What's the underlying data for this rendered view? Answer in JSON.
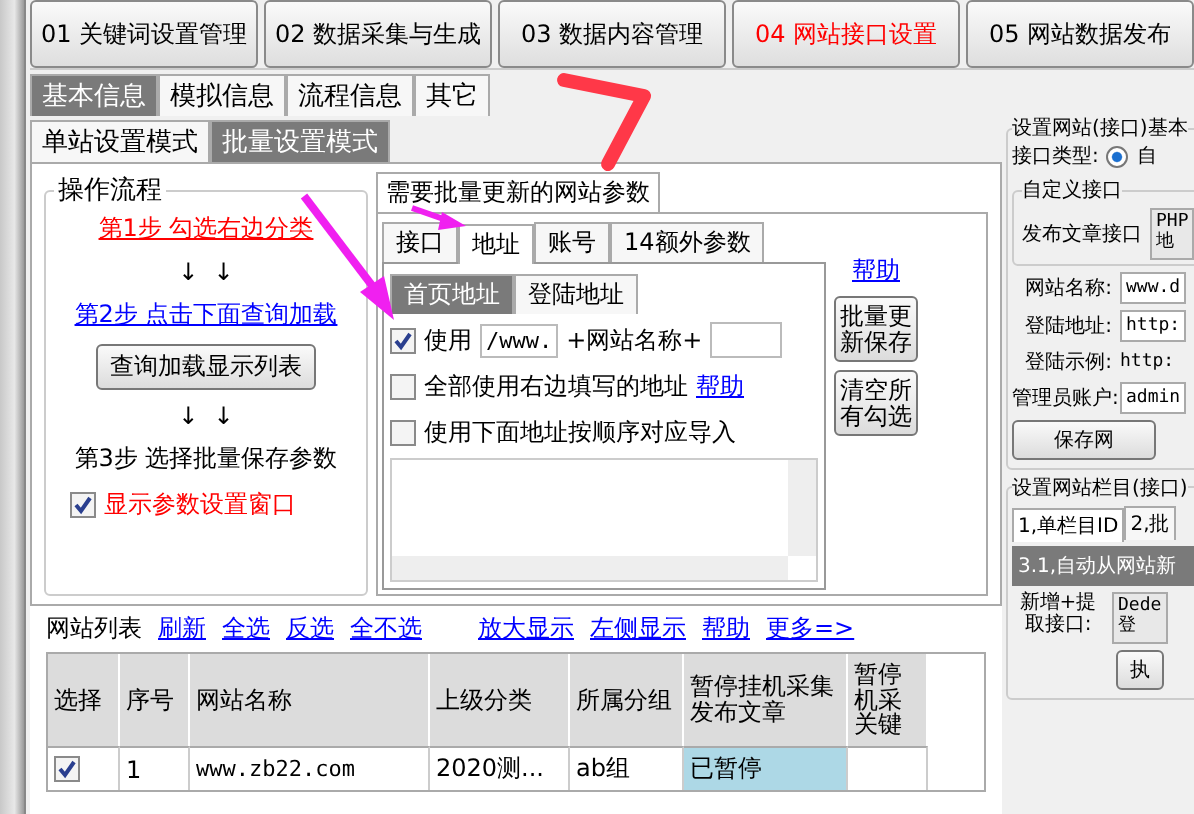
{
  "module_tabs": [
    {
      "label": "01 关键词设置管理",
      "selected": false
    },
    {
      "label": "02 数据采集与生成",
      "selected": false
    },
    {
      "label": "03 数据内容管理",
      "selected": false
    },
    {
      "label": "04 网站接口设置",
      "selected": true
    },
    {
      "label": "05 网站数据发布",
      "selected": false
    }
  ],
  "info_tabs": [
    {
      "label": "基本信息",
      "selected": true
    },
    {
      "label": "模拟信息",
      "selected": false
    },
    {
      "label": "流程信息",
      "selected": false
    },
    {
      "label": "其它",
      "selected": false
    }
  ],
  "mode_tabs": [
    {
      "label": "单站设置模式",
      "selected": false
    },
    {
      "label": "批量设置模式",
      "selected": true
    }
  ],
  "workflow": {
    "title": "操作流程",
    "step1": "第1步  勾选右边分类",
    "arrows_1": "↓  ↓",
    "step2": "第2步  点击下面查询加载",
    "load_button": "查询加载显示列表",
    "arrows_2": "↓  ↓",
    "step3": "第3步  选择批量保存参数",
    "show_window": {
      "label": "显示参数设置窗口",
      "checked": true
    }
  },
  "batch_params": {
    "title": "需要批量更新的网站参数",
    "tabs": [
      {
        "label": "接口",
        "selected": false
      },
      {
        "label": "地址",
        "selected": true
      },
      {
        "label": "账号",
        "selected": false
      },
      {
        "label": "14额外参数",
        "selected": false
      }
    ],
    "address_tabs": [
      {
        "label": "首页地址",
        "selected": true
      },
      {
        "label": "登陆地址",
        "selected": false
      }
    ],
    "options": [
      {
        "kind": "prefix",
        "label": "使用",
        "checked": true,
        "prefix": "/www.",
        "middle": "+网站名称+"
      },
      {
        "kind": "link",
        "label": "全部使用右边填写的地址",
        "checked": false,
        "link": "帮助"
      },
      {
        "kind": "plain",
        "label": "使用下面地址按顺序对应导入",
        "checked": false
      }
    ],
    "help_link": "帮助",
    "buttons": [
      "批量更新保存",
      "清空所有勾选"
    ]
  },
  "site_list": {
    "title": "网站列表",
    "links": [
      "刷新",
      "全选",
      "反选",
      "全不选",
      "放大显示",
      "左侧显示",
      "帮助",
      "更多=>"
    ],
    "columns": [
      "选择",
      "序号",
      "网站名称",
      "上级分类",
      "所属分组",
      "暂停挂机采集发布文章",
      "暂停机采关键"
    ],
    "rows": [
      {
        "selected": true,
        "number": "1",
        "name": "www.zb22.com",
        "parent": "2020测...",
        "group": "ab组",
        "paused": "已暂停"
      }
    ]
  },
  "site_info": {
    "title": "设置网站(接口)基本",
    "type_label": "接口类型:",
    "type_option": {
      "label": "自",
      "selected": true
    },
    "custom_title": "自定义接口",
    "publish_label": "发布文章接口",
    "publish_value": [
      "PHP",
      "地"
    ],
    "fields": [
      {
        "kind": "input",
        "label": "网站名称:",
        "value": "www.d"
      },
      {
        "kind": "input",
        "label": "登陆地址:",
        "value": "http:"
      },
      {
        "kind": "text",
        "label": "登陆示例:",
        "value": "http:"
      },
      {
        "kind": "input",
        "label": "管理员账户:",
        "value": "admin"
      }
    ],
    "save_button": "保存网"
  },
  "column_info": {
    "title": "设置网站栏目(接口)",
    "tabs": [
      {
        "label": "1,单栏目ID",
        "selected": true
      },
      {
        "label": "2,批",
        "selected": false
      }
    ],
    "section": "3.1,自动从网站新",
    "extract_label": "新增+提取接口:",
    "extract_value": [
      "Dede",
      "登"
    ],
    "run_button": "执"
  }
}
